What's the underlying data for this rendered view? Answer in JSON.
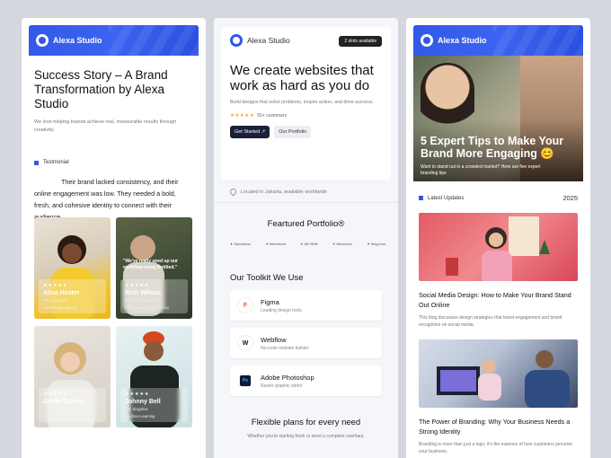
{
  "brand": "Alexa Studio",
  "card1": {
    "title": "Success Story – A Brand Transformation by Alexa Studio",
    "subtitle": "We love helping brands achieve real, measurable results through creativity.",
    "tag": "Testmonial",
    "quote": "Their brand lacked consistency, and their online engagement was low. They needed a bold, fresh, and cohesive identity to connect with their audience.",
    "people": [
      {
        "stars": "★★★★★",
        "name": "Alisa Hester",
        "role1": "PM, Hourglass",
        "role2": "Web Design Agency"
      },
      {
        "stars": "★★★★★",
        "name": "Rich Wilson",
        "role1": "COO, Command+R",
        "role2": "Web Development Agency",
        "quote": "\"We've really sped up our workflow using Untitled.\""
      },
      {
        "stars": "★★★★★",
        "name": "Annie Stanley",
        "role1": "Designer, Catalog",
        "role2": "UX Agency"
      },
      {
        "stars": "★★★★★",
        "name": "Johnny Bell",
        "role1": "PM, Sisyphus",
        "role2": "Machine Learning"
      }
    ]
  },
  "card2": {
    "badge": "2 slots available",
    "title": "We create websites that work as hard as you do",
    "subtitle": "Build designs that solve problems, inspire action, and drive success.",
    "stars": "★★★★★",
    "customers": "50+ customers",
    "btn_primary": "Get Started ↗",
    "btn_secondary": "Our Portfolio",
    "location": "Located in Jakarta, available worldwide",
    "portfolio_title": "Feartured Portfolio®",
    "brands": [
      "Spinaltouz",
      "Wavefront",
      "Alt+Shift",
      "Nietzsche",
      "Sisyphus"
    ],
    "toolkit_title": "Our Toolkit We Use",
    "tools": [
      {
        "icon": "F",
        "name": "Figma",
        "desc": "Leading design tools"
      },
      {
        "icon": "W",
        "name": "Webflow",
        "desc": "No-code website builder"
      },
      {
        "icon": "Ps",
        "name": "Adobe Photoshop",
        "desc": "Raster graphic editor"
      }
    ],
    "plans_title": "Flexible plans for every need",
    "plans_sub": "Whether you're starting fresh or need a complete overhaul,"
  },
  "card3": {
    "hero_title": "5 Expert Tips to Make Your Brand More Engaging 😊",
    "hero_sub": "Want to stand out in a crowded market? Here are five expert branding tips",
    "latest_label": "Latest Updates",
    "year": "2025",
    "posts": [
      {
        "title": "Social Media Design: How to Make Your Brand Stand Out Online",
        "desc": "This blog discusses design strategies that boost engagement and brand recognition on social media."
      },
      {
        "title": "The Power of Branding: Why Your Business Needs a Strong Identity",
        "desc": "Branding is more than just a logo; it's the essence of how customers perceive your business."
      }
    ]
  }
}
